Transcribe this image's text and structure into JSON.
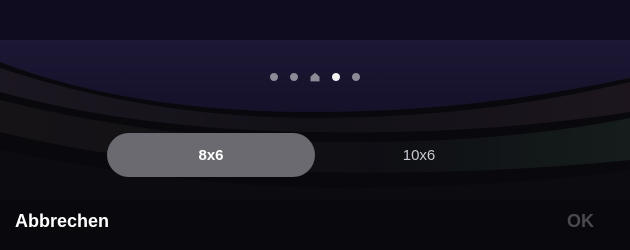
{
  "page_dots": {
    "count": 5,
    "home_index": 2,
    "active_index": 3,
    "home_icon": "home-icon"
  },
  "grid_options": {
    "options": [
      {
        "label": "8x6",
        "selected": true
      },
      {
        "label": "10x6",
        "selected": false
      }
    ]
  },
  "actions": {
    "cancel_label": "Abbrechen",
    "ok_label": "OK"
  },
  "colors": {
    "background": "#09090d",
    "selected_segment": "#6b6a70",
    "disabled_text": "#4a4950"
  }
}
